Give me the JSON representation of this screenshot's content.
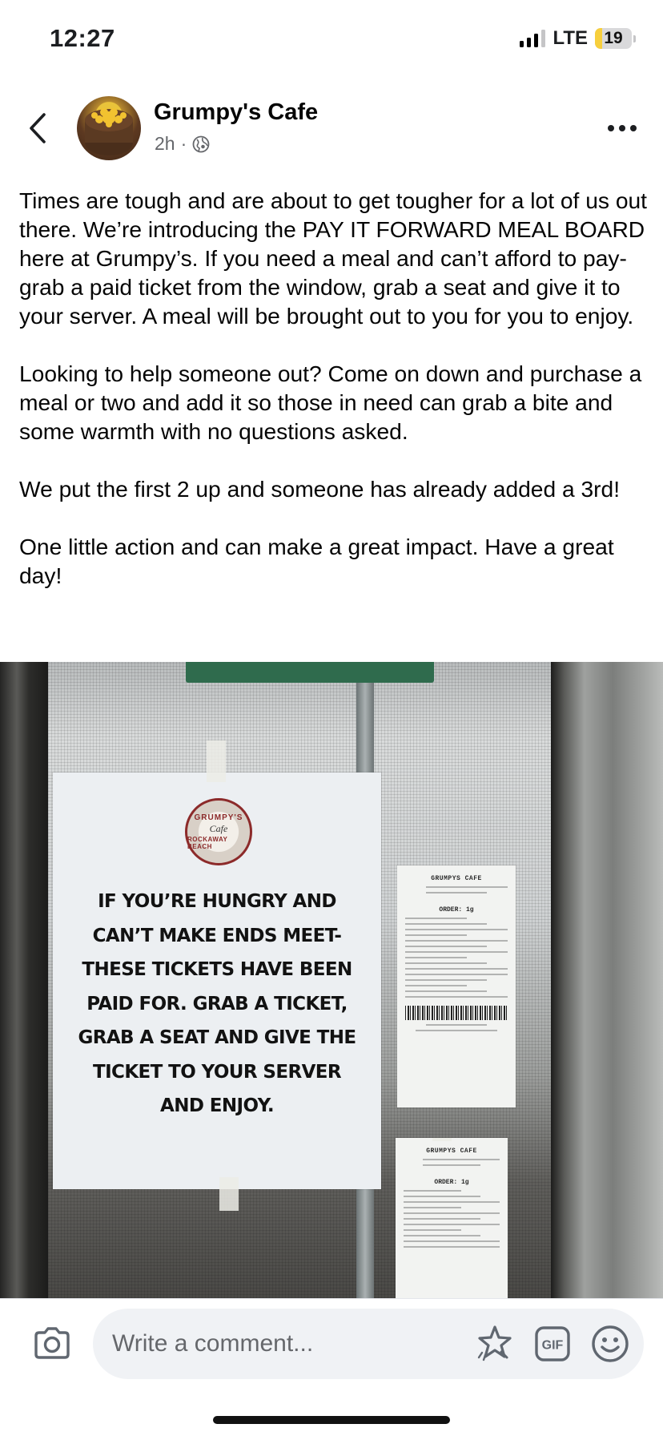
{
  "status_bar": {
    "time": "12:27",
    "network": "LTE",
    "battery_level": "19",
    "battery_fraction": 0.19
  },
  "post": {
    "author": "Grumpy's Cafe",
    "time_ago": "2h",
    "separator": "·",
    "audience_icon": "globe-icon",
    "paragraphs": [
      "Times are tough and are about to get tougher for a lot of us out there. We’re introducing the PAY IT FORWARD MEAL BOARD here at Grumpy’s. If you need a meal and can’t afford to pay- grab a paid ticket from the window, grab a seat and give it to your server. A meal will be brought out to you for you to enjoy.",
      "Looking to help someone out? Come on down and purchase a meal or two and add it so those in need can grab a bite and some warmth with no questions asked.",
      "We put the first 2 up and someone has already added a 3rd!",
      "One little action and can make a great impact. Have a great day!"
    ]
  },
  "photo": {
    "sign": {
      "logo_top": "GRUMPY'S",
      "logo_mid": "Cafe",
      "logo_bottom": "ROCKAWAY BEACH",
      "text": "IF YOU’RE HUNGRY AND\nCAN’T MAKE ENDS MEET-\nTHESE TICKETS HAVE BEEN\nPAID FOR. GRAB A TICKET,\nGRAB A SEAT AND GIVE THE\nTICKET TO YOUR SERVER\nAND ENJOY."
    },
    "receipts": [
      {
        "title": "GRUMPYS CAFE",
        "order": "ORDER: 1g"
      },
      {
        "title": "GRUMPYS CAFE",
        "order": "ORDER: 1g"
      }
    ]
  },
  "comment_bar": {
    "placeholder": "Write a comment...",
    "icons": [
      "camera-icon",
      "sticker-icon",
      "gif-icon",
      "emoji-icon"
    ],
    "gif_label": "GIF"
  },
  "colors": {
    "text_primary": "#050505",
    "text_secondary": "#65676b",
    "input_bg": "#f0f2f5",
    "battery_fill": "#f7cf3d"
  }
}
